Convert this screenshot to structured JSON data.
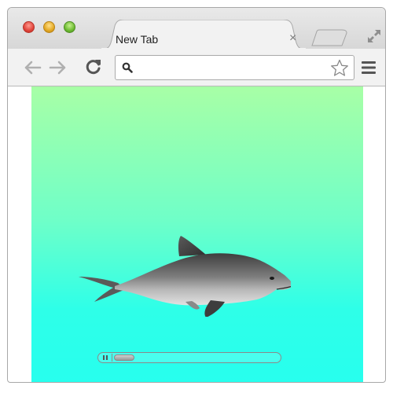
{
  "window": {
    "controls": [
      "close",
      "minimize",
      "zoom"
    ]
  },
  "tab": {
    "title": "New Tab",
    "close_glyph": "×"
  },
  "toolbar": {
    "back_icon": "arrow-left-icon",
    "forward_icon": "arrow-right-icon",
    "reload_icon": "reload-icon",
    "omnibox_value": "",
    "omnibox_placeholder": "",
    "search_icon": "magnifier-icon",
    "bookmark_icon": "star-icon",
    "menu_icon": "hamburger-icon"
  },
  "page": {
    "background_top": "#a8ffa6",
    "background_bottom": "#27ffee",
    "image": "dolphin",
    "media_controls": {
      "play_state": "pause-icon",
      "progress": 0.05
    }
  }
}
